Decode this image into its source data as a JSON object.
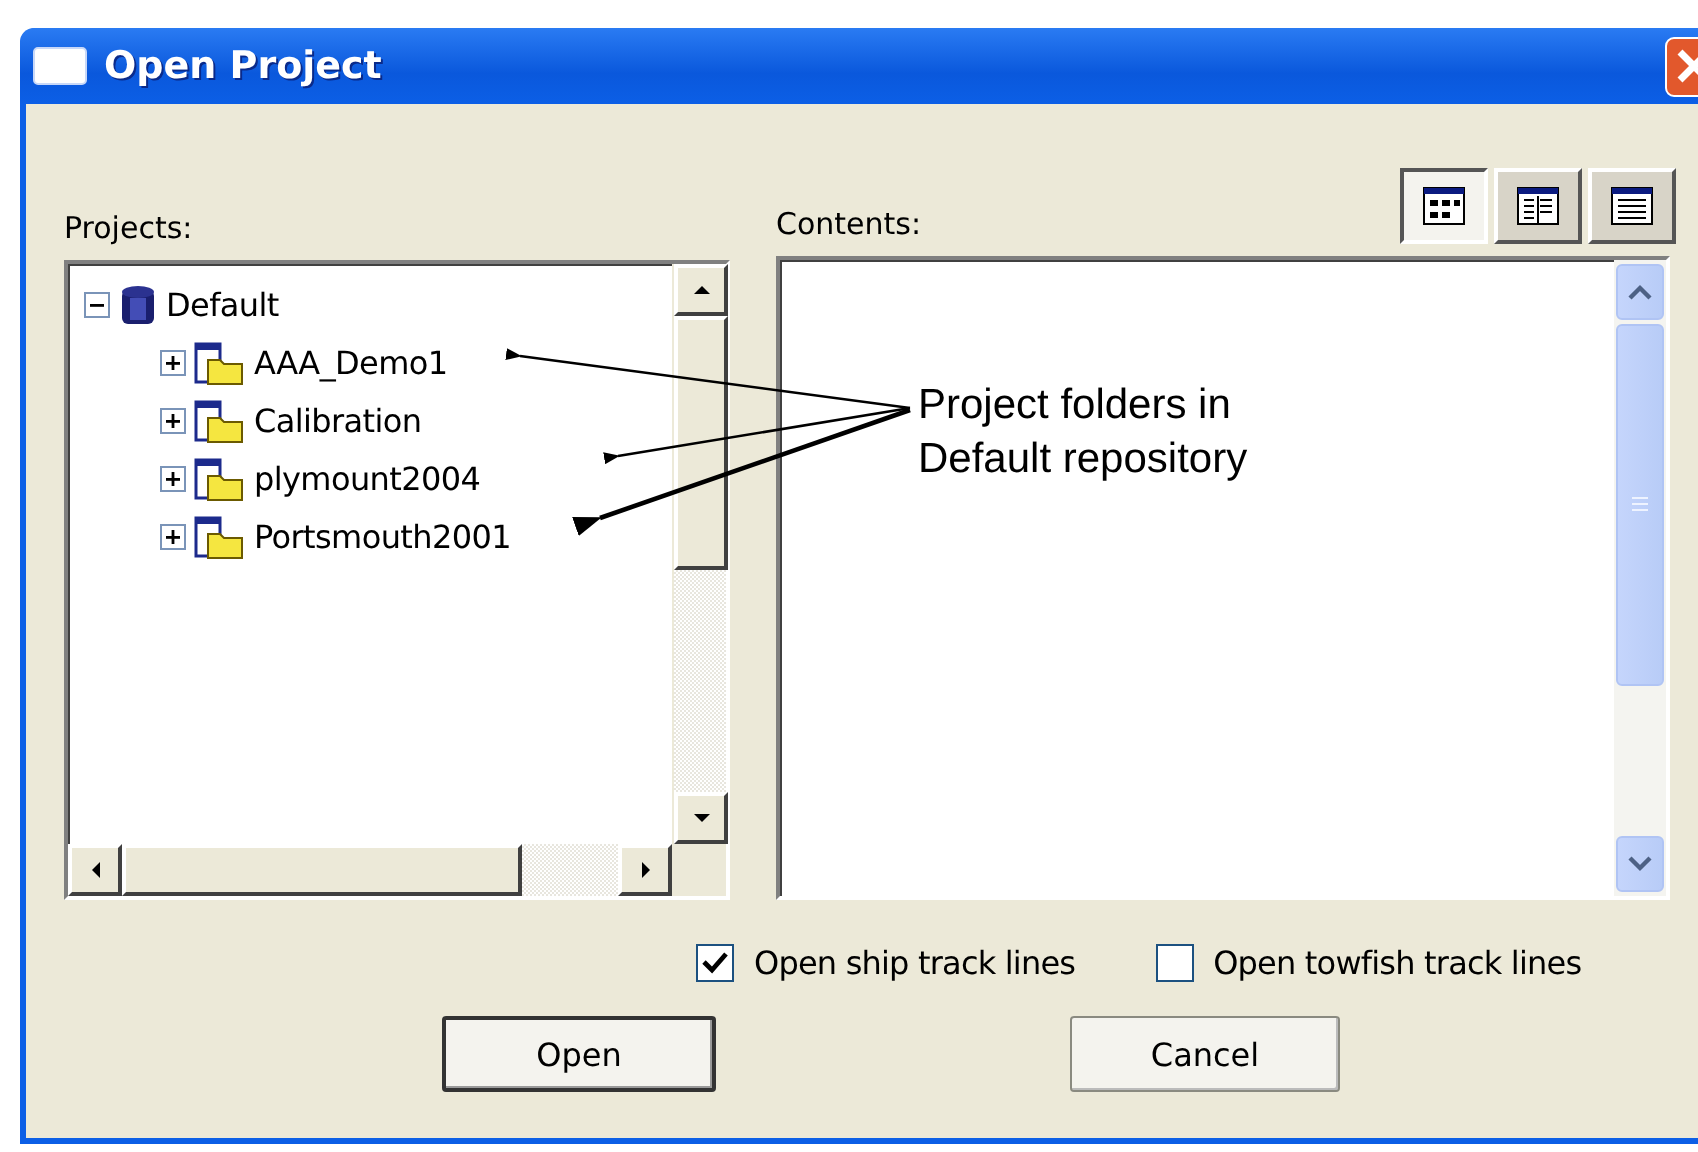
{
  "window": {
    "title": "Open Project"
  },
  "projects": {
    "label": "Projects:",
    "tree": [
      {
        "label": "Default",
        "kind": "repository",
        "expanded": true,
        "children": [
          {
            "label": "AAA_Demo1",
            "kind": "project",
            "expanded": false
          },
          {
            "label": "Calibration",
            "kind": "project",
            "expanded": false
          },
          {
            "label": "plymount2004",
            "kind": "project",
            "expanded": false
          },
          {
            "label": "Portsmouth2001",
            "kind": "project",
            "expanded": false
          }
        ]
      }
    ]
  },
  "contents": {
    "label": "Contents:",
    "view_buttons": [
      {
        "kind": "icons",
        "selected": true
      },
      {
        "kind": "list",
        "selected": false
      },
      {
        "kind": "details",
        "selected": false
      }
    ]
  },
  "options": [
    {
      "label": "Open ship track lines",
      "checked": true
    },
    {
      "label": "Open towfish track lines",
      "checked": false
    }
  ],
  "buttons": [
    {
      "label": "Open",
      "default": true
    },
    {
      "label": "Cancel",
      "default": false
    }
  ],
  "annotation": {
    "text": "Project folders in Default repository"
  }
}
